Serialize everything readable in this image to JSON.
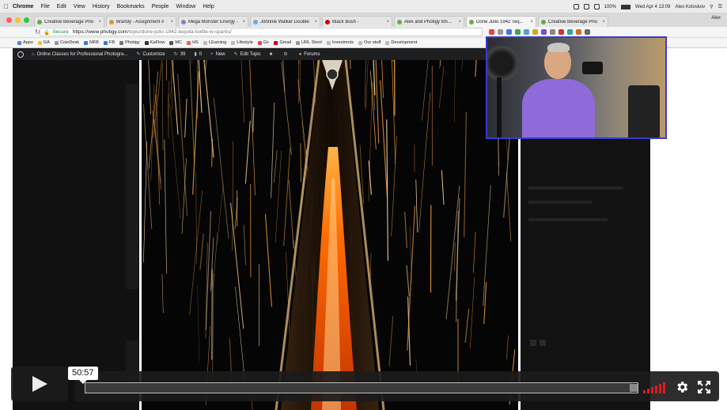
{
  "menubar": {
    "app": "Chrome",
    "menus": [
      "File",
      "Edit",
      "View",
      "History",
      "Bookmarks",
      "People",
      "Window",
      "Help"
    ],
    "battery": "100%",
    "clock": "Wed Apr 4  13:09",
    "user": "Alex Koloskov"
  },
  "tabs": [
    {
      "label": "Creative Beverage Pho"
    },
    {
      "label": "Brandy - Assignment #"
    },
    {
      "label": "Mega Monster Energy -"
    },
    {
      "label": "Johnnie Walker Double"
    },
    {
      "label": "Black Bush -"
    },
    {
      "label": "Alex and Photigy tim..."
    },
    {
      "label": "Done Julio 1942 Teq..."
    },
    {
      "label": "Creative Beverage Pho"
    }
  ],
  "tabstrip_user": "Alex",
  "address": {
    "secure": "Secure",
    "host": "https://www.photigy.com",
    "path": "/topic/done-julio-1942-tequila-bottle-w-sparks/"
  },
  "bookmarks": [
    "Apps",
    "GA",
    "CoinDesk",
    "MFB",
    "FB",
    "Photigy",
    "KaFlow",
    "MC",
    "HS",
    "LEarning",
    "Lifestyle",
    "G+",
    "Gmail",
    "URL Short",
    "Investmnts",
    "Our stuff",
    "Development"
  ],
  "wpbar": {
    "site": "Online Classes for Professional Photogra...",
    "customize": "Customize",
    "updates": "39",
    "comments": "0",
    "new": "New",
    "edit": "Edit Topic",
    "forums": "Forums"
  },
  "video": {
    "time": "50:57",
    "progress": 0.99
  },
  "colors": {
    "accent_red": "#e8151c",
    "cam_border": "#3a3ad0",
    "flame": "#ff6a00"
  }
}
